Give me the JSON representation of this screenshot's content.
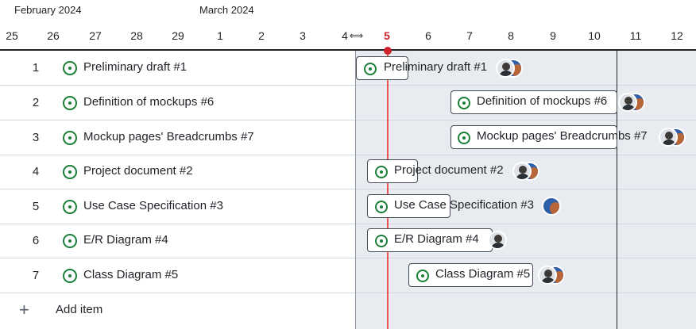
{
  "timeline": {
    "months": [
      {
        "label": "February 2024"
      },
      {
        "label": "March 2024"
      }
    ],
    "days": [
      "25",
      "26",
      "27",
      "28",
      "29",
      "1",
      "2",
      "3",
      "4",
      "5",
      "6",
      "7",
      "8",
      "9",
      "10",
      "11",
      "12"
    ],
    "today": "5"
  },
  "items": [
    {
      "num": "1",
      "title": "Preliminary draft  #1",
      "bar_label": "Preliminary draft #1",
      "avatars": [
        "person-avatar",
        "person-avatar"
      ]
    },
    {
      "num": "2",
      "title": "Definition of mockups  #6",
      "bar_label": "Definition of mockups #6",
      "avatars": [
        "person-avatar",
        "person-avatar"
      ]
    },
    {
      "num": "3",
      "title": "Mockup pages' Breadcrumbs  #7",
      "bar_label": "Mockup pages' Breadcrumbs #7",
      "avatars": [
        "person-avatar",
        "person-avatar"
      ]
    },
    {
      "num": "4",
      "title": "Project document  #2",
      "bar_label": "Project document #2",
      "avatars": [
        "person-avatar",
        "person-avatar"
      ]
    },
    {
      "num": "5",
      "title": "Use Case Specification  #3",
      "bar_label": "Use Case Specification #3",
      "avatars": [
        "person-avatar"
      ]
    },
    {
      "num": "6",
      "title": "E/R Diagram  #4",
      "bar_label": "E/R Diagram #4",
      "avatars": [
        "person-avatar"
      ]
    },
    {
      "num": "7",
      "title": "Class Diagram  #5",
      "bar_label": "Class Diagram #5",
      "avatars": [
        "person-avatar",
        "person-avatar"
      ]
    }
  ],
  "add_item_label": "Add item",
  "colors": {
    "status_open": "#1a7f37",
    "today_marker": "#cf222e",
    "timeline_bg": "#e8ebef"
  },
  "icons": {
    "status": "issue-opened-icon",
    "add": "plus-icon",
    "resize": "column-resize-icon"
  }
}
